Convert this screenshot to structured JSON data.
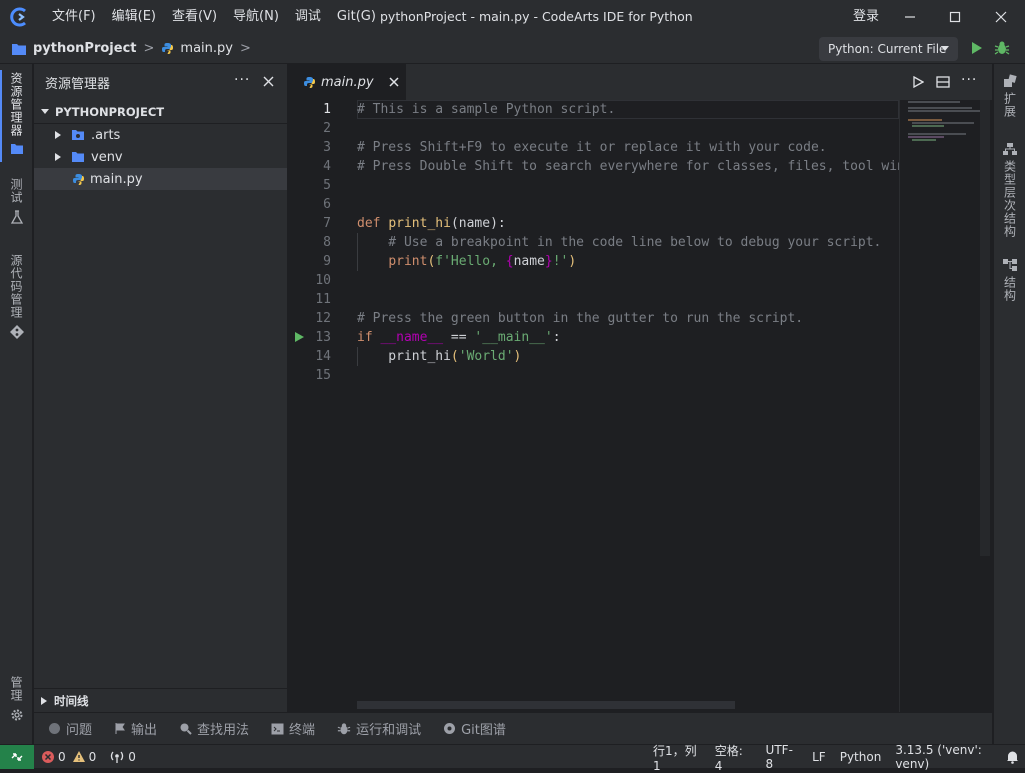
{
  "titlebar": {
    "menus": [
      "文件(F)",
      "编辑(E)",
      "查看(V)",
      "导航(N)",
      "调试",
      "Git(G)"
    ],
    "window_title": "pythonProject - main.py - CodeArts IDE for Python",
    "login": "登录"
  },
  "breadcrumb": {
    "project": "pythonProject",
    "file": "main.py"
  },
  "run_config": "Python: Current File",
  "activity_left": {
    "explorer": "资源管理器",
    "test": "测试",
    "source_control": "源代码管理",
    "manage": "管理"
  },
  "activity_right": {
    "extensions": "扩展",
    "type_hierarchy": "类型层次结构",
    "structure": "结构"
  },
  "sidebar": {
    "title": "资源管理器",
    "root": "PYTHONPROJECT",
    "items": [
      {
        "label": ".arts"
      },
      {
        "label": "venv"
      },
      {
        "label": "main.py"
      }
    ],
    "timeline": "时间线"
  },
  "editor": {
    "tab_label": "main.py",
    "lines": [
      {
        "n": "1",
        "segs": [
          {
            "t": "# This is a sample Python script.",
            "c": "c-com"
          }
        ]
      },
      {
        "n": "2",
        "segs": []
      },
      {
        "n": "3",
        "segs": [
          {
            "t": "# Press Shift+F9 to execute it or replace it with your code.",
            "c": "c-com"
          }
        ]
      },
      {
        "n": "4",
        "segs": [
          {
            "t": "# Press Double Shift to search everywhere for classes, files, tool wind",
            "c": "c-com"
          }
        ]
      },
      {
        "n": "5",
        "segs": []
      },
      {
        "n": "6",
        "segs": []
      },
      {
        "n": "7",
        "segs": [
          {
            "t": "def ",
            "c": "c-kw"
          },
          {
            "t": "print_hi",
            "c": "c-yellow"
          },
          {
            "t": "(name):",
            "c": ""
          }
        ]
      },
      {
        "n": "8",
        "segs": [
          {
            "t": "    # Use a breakpoint in the code line below to debug your script.",
            "c": "c-com"
          }
        ]
      },
      {
        "n": "9",
        "segs": [
          {
            "t": "    ",
            "c": ""
          },
          {
            "t": "print",
            "c": "c-kw"
          },
          {
            "t": "(",
            "c": "c-yellow"
          },
          {
            "t": "f'Hello, ",
            "c": "c-str"
          },
          {
            "t": "{",
            "c": "c-dunder"
          },
          {
            "t": "name",
            "c": ""
          },
          {
            "t": "}",
            "c": "c-dunder"
          },
          {
            "t": "!'",
            "c": "c-str"
          },
          {
            "t": ")",
            "c": "c-yellow"
          }
        ]
      },
      {
        "n": "10",
        "segs": []
      },
      {
        "n": "11",
        "segs": []
      },
      {
        "n": "12",
        "segs": [
          {
            "t": "# Press the green button in the gutter to run the script.",
            "c": "c-com"
          }
        ]
      },
      {
        "n": "13",
        "segs": [
          {
            "t": "if ",
            "c": "c-kw"
          },
          {
            "t": "__name__",
            "c": "c-dunder"
          },
          {
            "t": " == ",
            "c": ""
          },
          {
            "t": "'__main__'",
            "c": "c-str"
          },
          {
            "t": ":",
            "c": ""
          }
        ]
      },
      {
        "n": "14",
        "segs": [
          {
            "t": "    print_hi",
            "c": ""
          },
          {
            "t": "(",
            "c": "c-yellow"
          },
          {
            "t": "'World'",
            "c": "c-str"
          },
          {
            "t": ")",
            "c": "c-yellow"
          }
        ]
      },
      {
        "n": "15",
        "segs": []
      }
    ]
  },
  "panel_tabs": [
    "问题",
    "输出",
    "查找用法",
    "终端",
    "运行和调试",
    "Git图谱"
  ],
  "status": {
    "errors": "0",
    "warnings": "0",
    "ports": "0",
    "position": "行1，列1",
    "indent": "空格: 4",
    "encoding": "UTF-8",
    "eol": "LF",
    "language": "Python",
    "interpreter": "3.13.5 ('venv': venv)"
  },
  "colors": {
    "accent_green": "#5fb865",
    "status_remote_bg": "#24824a",
    "folder_blue": "#548af7",
    "python_icon": "#3c8de0"
  }
}
